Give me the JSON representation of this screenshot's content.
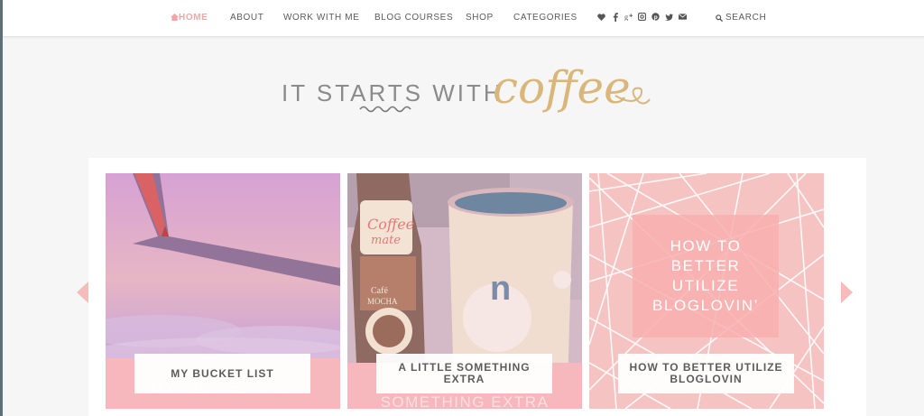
{
  "nav": {
    "items": [
      {
        "label": "HOME",
        "active": true
      },
      {
        "label": "ABOUT"
      },
      {
        "label": "WORK WITH ME"
      },
      {
        "label": "BLOG COURSES"
      },
      {
        "label": "SHOP"
      },
      {
        "label": "CATEGORIES"
      }
    ],
    "socials": [
      "heart-icon",
      "facebook-icon",
      "google-plus-icon",
      "instagram-icon",
      "pinterest-icon",
      "twitter-icon",
      "email-icon"
    ],
    "search_label": "SEARCH"
  },
  "logo": {
    "text": "IT STARTS WITH",
    "script": "coffee"
  },
  "slider": {
    "slides": [
      {
        "caption": "MY BUCKET LIST",
        "ghost": "MY BUCKET LIST"
      },
      {
        "caption": "A LITTLE SOMETHING EXTRA",
        "ghost": "SOMETHING EXTRA"
      },
      {
        "caption": "HOW TO BETTER UTILIZE BLOGLOVIN",
        "overlay": "HOW TO BETTER UTILIZE BLOGLOVIN’"
      }
    ]
  },
  "colors": {
    "accent": "#f4a6a6",
    "gold": "#d9b77a",
    "text": "#5a5a5a"
  }
}
